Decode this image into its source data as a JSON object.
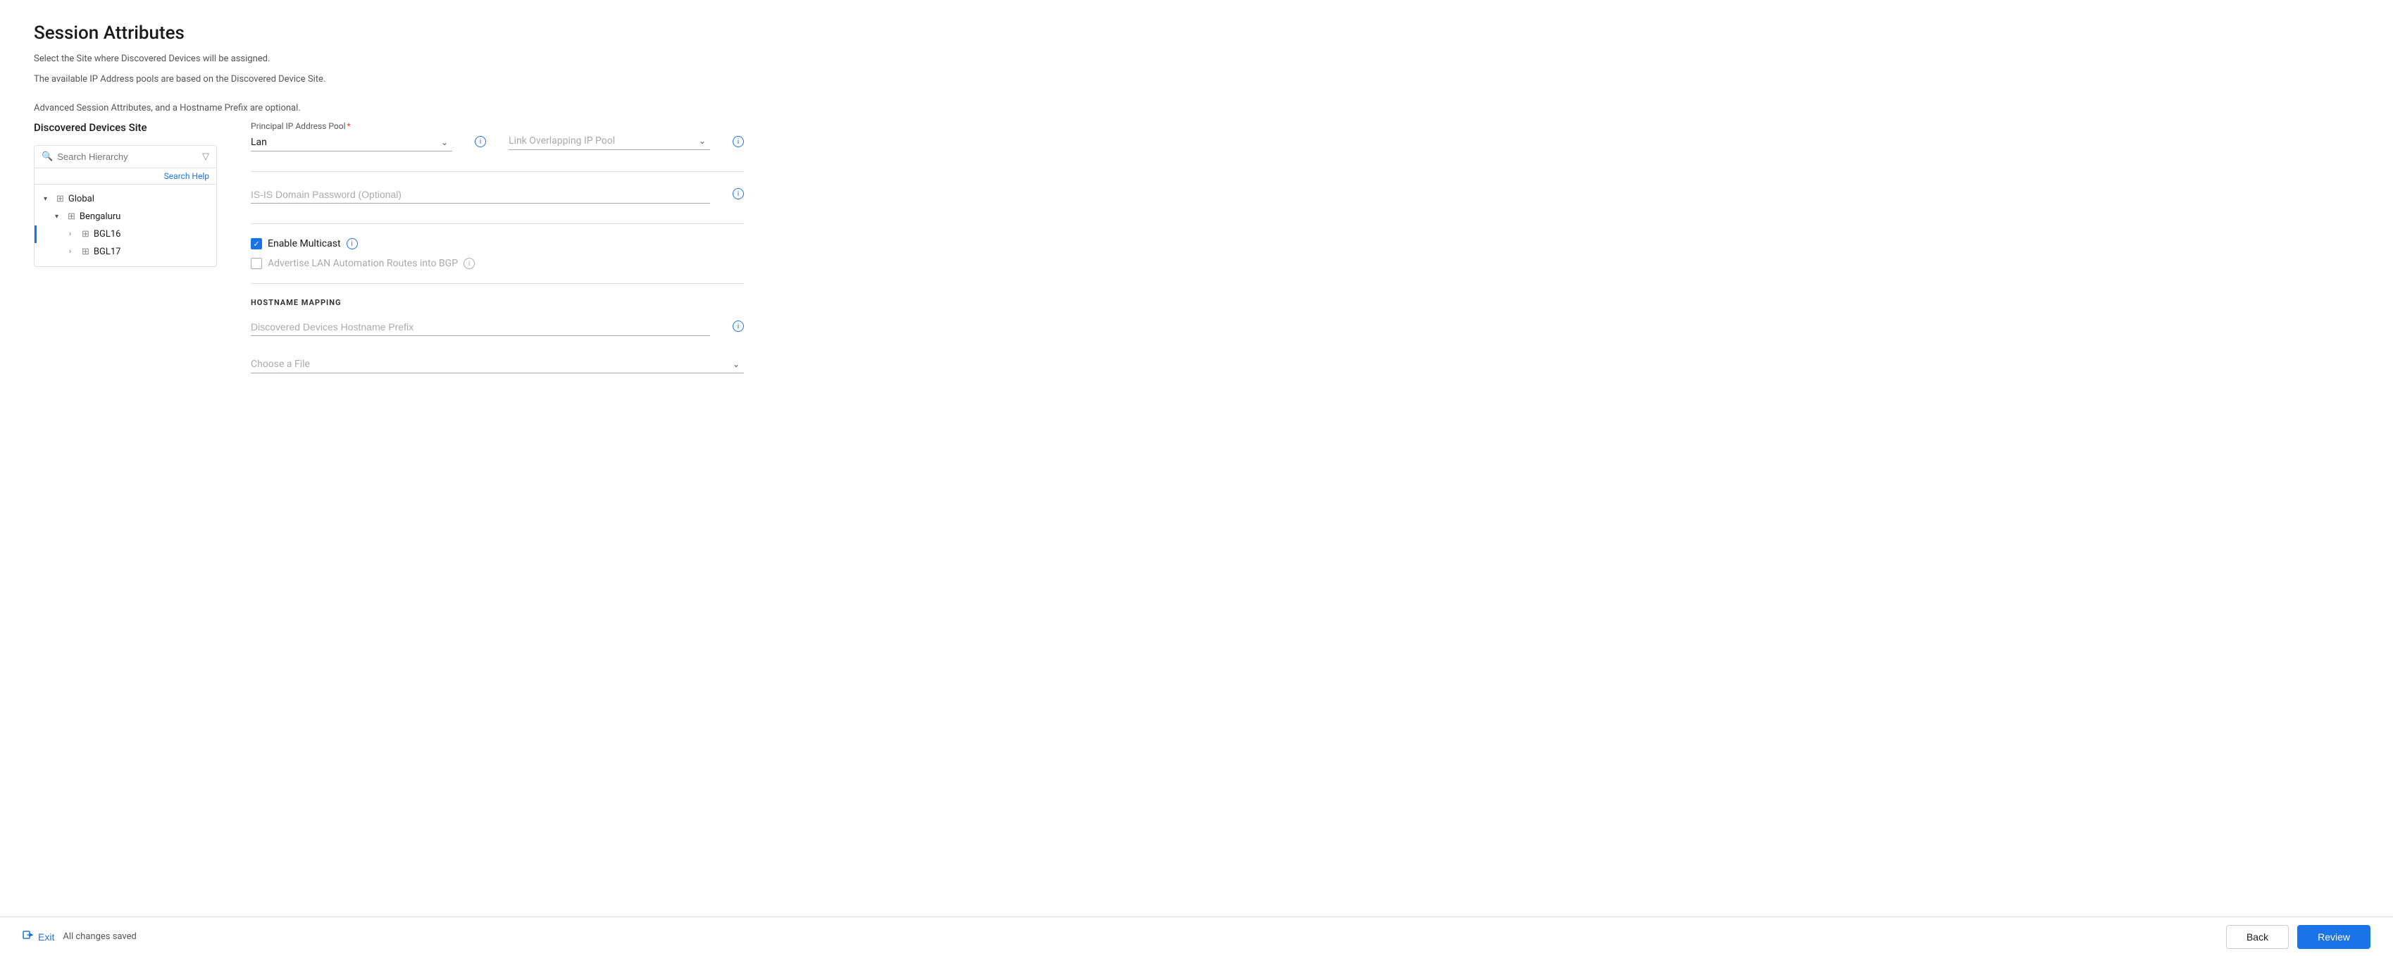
{
  "page": {
    "title": "Session Attributes",
    "description1": "Select the Site where Discovered Devices will be assigned.",
    "description2": "The available IP Address pools are based on the Discovered Device Site.",
    "description3": "Advanced Session Attributes, and a Hostname Prefix are optional."
  },
  "left_panel": {
    "section_label": "Discovered Devices Site",
    "search_placeholder": "Search Hierarchy",
    "search_help": "Search Help",
    "tree": [
      {
        "id": "global",
        "label": "Global",
        "level": 1,
        "expanded": true,
        "toggle": "▾"
      },
      {
        "id": "bengaluru",
        "label": "Bengaluru",
        "level": 2,
        "expanded": true,
        "toggle": "▾"
      },
      {
        "id": "bgl16",
        "label": "BGL16",
        "level": 3,
        "expanded": false,
        "toggle": "›",
        "selected": true
      },
      {
        "id": "bgl17",
        "label": "BGL17",
        "level": 3,
        "expanded": false,
        "toggle": "›"
      }
    ]
  },
  "right_panel": {
    "principal_ip_label": "Principal IP Address Pool",
    "principal_ip_value": "Lan",
    "link_overlapping_label": "Link Overlapping IP Pool",
    "link_overlapping_placeholder": "Link Overlapping IP Pool",
    "isis_label": "IS-IS Domain Password (Optional)",
    "isis_placeholder": "IS-IS Domain Password (Optional)",
    "enable_multicast_label": "Enable Multicast",
    "advertise_label": "Advertise LAN Automation Routes into BGP",
    "hostname_section": "HOSTNAME MAPPING",
    "hostname_prefix_placeholder": "Discovered Devices Hostname Prefix",
    "choose_file_placeholder": "Choose a File"
  },
  "footer": {
    "exit_label": "Exit",
    "saved_label": "All changes saved",
    "back_label": "Back",
    "review_label": "Review"
  },
  "icons": {
    "search": "🔍",
    "filter": "⊟",
    "info": "i",
    "exit": "↩",
    "chevron_down": "⌄",
    "chevron_right": "›",
    "chevron_expand": "▾",
    "site": "⊞"
  }
}
